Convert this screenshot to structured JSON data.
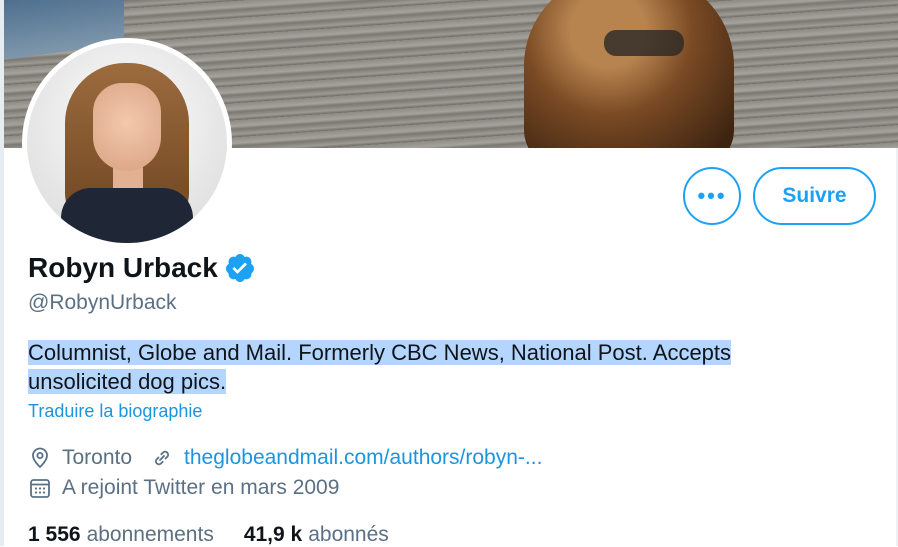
{
  "profile": {
    "name": "Robyn Urback",
    "handle": "@RobynUrback",
    "bio_highlighted": "Columnist, Globe and Mail. Formerly CBC News, National Post. Accepts unsolicited dog pics.",
    "translate_label": "Traduire la biographie",
    "location": "Toronto",
    "website": "theglobeandmail.com/authors/robyn-...",
    "joined": "A rejoint Twitter en mars 2009"
  },
  "actions": {
    "more_label": "•••",
    "follow_label": "Suivre"
  },
  "stats": {
    "following_count": "1 556",
    "following_label": "abonnements",
    "followers_count": "41,9 k",
    "followers_label": "abonnés"
  },
  "icons": {
    "verified": "verified-badge-icon",
    "location": "location-pin-icon",
    "link": "link-icon",
    "calendar": "calendar-icon"
  },
  "colors": {
    "accent": "#1da1f2",
    "link": "#1b95e0",
    "secondary_text": "#5b7083",
    "selection": "#b4d5fe"
  }
}
